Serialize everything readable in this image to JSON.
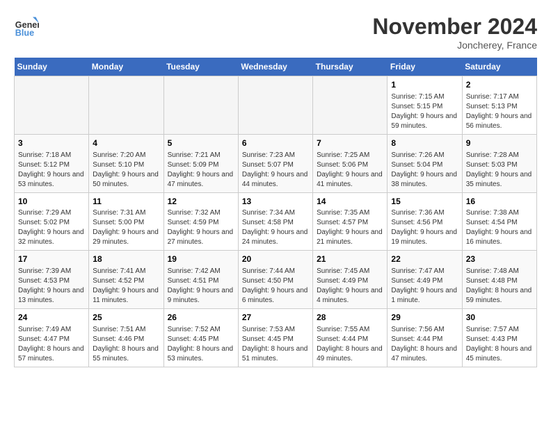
{
  "header": {
    "logo_line1": "General",
    "logo_line2": "Blue",
    "month_title": "November 2024",
    "location": "Joncherey, France"
  },
  "days_of_week": [
    "Sunday",
    "Monday",
    "Tuesday",
    "Wednesday",
    "Thursday",
    "Friday",
    "Saturday"
  ],
  "weeks": [
    [
      {
        "day": "",
        "empty": true
      },
      {
        "day": "",
        "empty": true
      },
      {
        "day": "",
        "empty": true
      },
      {
        "day": "",
        "empty": true
      },
      {
        "day": "",
        "empty": true
      },
      {
        "day": "1",
        "sunrise": "Sunrise: 7:15 AM",
        "sunset": "Sunset: 5:15 PM",
        "daylight": "Daylight: 9 hours and 59 minutes."
      },
      {
        "day": "2",
        "sunrise": "Sunrise: 7:17 AM",
        "sunset": "Sunset: 5:13 PM",
        "daylight": "Daylight: 9 hours and 56 minutes."
      }
    ],
    [
      {
        "day": "3",
        "sunrise": "Sunrise: 7:18 AM",
        "sunset": "Sunset: 5:12 PM",
        "daylight": "Daylight: 9 hours and 53 minutes."
      },
      {
        "day": "4",
        "sunrise": "Sunrise: 7:20 AM",
        "sunset": "Sunset: 5:10 PM",
        "daylight": "Daylight: 9 hours and 50 minutes."
      },
      {
        "day": "5",
        "sunrise": "Sunrise: 7:21 AM",
        "sunset": "Sunset: 5:09 PM",
        "daylight": "Daylight: 9 hours and 47 minutes."
      },
      {
        "day": "6",
        "sunrise": "Sunrise: 7:23 AM",
        "sunset": "Sunset: 5:07 PM",
        "daylight": "Daylight: 9 hours and 44 minutes."
      },
      {
        "day": "7",
        "sunrise": "Sunrise: 7:25 AM",
        "sunset": "Sunset: 5:06 PM",
        "daylight": "Daylight: 9 hours and 41 minutes."
      },
      {
        "day": "8",
        "sunrise": "Sunrise: 7:26 AM",
        "sunset": "Sunset: 5:04 PM",
        "daylight": "Daylight: 9 hours and 38 minutes."
      },
      {
        "day": "9",
        "sunrise": "Sunrise: 7:28 AM",
        "sunset": "Sunset: 5:03 PM",
        "daylight": "Daylight: 9 hours and 35 minutes."
      }
    ],
    [
      {
        "day": "10",
        "sunrise": "Sunrise: 7:29 AM",
        "sunset": "Sunset: 5:02 PM",
        "daylight": "Daylight: 9 hours and 32 minutes."
      },
      {
        "day": "11",
        "sunrise": "Sunrise: 7:31 AM",
        "sunset": "Sunset: 5:00 PM",
        "daylight": "Daylight: 9 hours and 29 minutes."
      },
      {
        "day": "12",
        "sunrise": "Sunrise: 7:32 AM",
        "sunset": "Sunset: 4:59 PM",
        "daylight": "Daylight: 9 hours and 27 minutes."
      },
      {
        "day": "13",
        "sunrise": "Sunrise: 7:34 AM",
        "sunset": "Sunset: 4:58 PM",
        "daylight": "Daylight: 9 hours and 24 minutes."
      },
      {
        "day": "14",
        "sunrise": "Sunrise: 7:35 AM",
        "sunset": "Sunset: 4:57 PM",
        "daylight": "Daylight: 9 hours and 21 minutes."
      },
      {
        "day": "15",
        "sunrise": "Sunrise: 7:36 AM",
        "sunset": "Sunset: 4:56 PM",
        "daylight": "Daylight: 9 hours and 19 minutes."
      },
      {
        "day": "16",
        "sunrise": "Sunrise: 7:38 AM",
        "sunset": "Sunset: 4:54 PM",
        "daylight": "Daylight: 9 hours and 16 minutes."
      }
    ],
    [
      {
        "day": "17",
        "sunrise": "Sunrise: 7:39 AM",
        "sunset": "Sunset: 4:53 PM",
        "daylight": "Daylight: 9 hours and 13 minutes."
      },
      {
        "day": "18",
        "sunrise": "Sunrise: 7:41 AM",
        "sunset": "Sunset: 4:52 PM",
        "daylight": "Daylight: 9 hours and 11 minutes."
      },
      {
        "day": "19",
        "sunrise": "Sunrise: 7:42 AM",
        "sunset": "Sunset: 4:51 PM",
        "daylight": "Daylight: 9 hours and 9 minutes."
      },
      {
        "day": "20",
        "sunrise": "Sunrise: 7:44 AM",
        "sunset": "Sunset: 4:50 PM",
        "daylight": "Daylight: 9 hours and 6 minutes."
      },
      {
        "day": "21",
        "sunrise": "Sunrise: 7:45 AM",
        "sunset": "Sunset: 4:49 PM",
        "daylight": "Daylight: 9 hours and 4 minutes."
      },
      {
        "day": "22",
        "sunrise": "Sunrise: 7:47 AM",
        "sunset": "Sunset: 4:49 PM",
        "daylight": "Daylight: 9 hours and 1 minute."
      },
      {
        "day": "23",
        "sunrise": "Sunrise: 7:48 AM",
        "sunset": "Sunset: 4:48 PM",
        "daylight": "Daylight: 8 hours and 59 minutes."
      }
    ],
    [
      {
        "day": "24",
        "sunrise": "Sunrise: 7:49 AM",
        "sunset": "Sunset: 4:47 PM",
        "daylight": "Daylight: 8 hours and 57 minutes."
      },
      {
        "day": "25",
        "sunrise": "Sunrise: 7:51 AM",
        "sunset": "Sunset: 4:46 PM",
        "daylight": "Daylight: 8 hours and 55 minutes."
      },
      {
        "day": "26",
        "sunrise": "Sunrise: 7:52 AM",
        "sunset": "Sunset: 4:45 PM",
        "daylight": "Daylight: 8 hours and 53 minutes."
      },
      {
        "day": "27",
        "sunrise": "Sunrise: 7:53 AM",
        "sunset": "Sunset: 4:45 PM",
        "daylight": "Daylight: 8 hours and 51 minutes."
      },
      {
        "day": "28",
        "sunrise": "Sunrise: 7:55 AM",
        "sunset": "Sunset: 4:44 PM",
        "daylight": "Daylight: 8 hours and 49 minutes."
      },
      {
        "day": "29",
        "sunrise": "Sunrise: 7:56 AM",
        "sunset": "Sunset: 4:44 PM",
        "daylight": "Daylight: 8 hours and 47 minutes."
      },
      {
        "day": "30",
        "sunrise": "Sunrise: 7:57 AM",
        "sunset": "Sunset: 4:43 PM",
        "daylight": "Daylight: 8 hours and 45 minutes."
      }
    ]
  ]
}
